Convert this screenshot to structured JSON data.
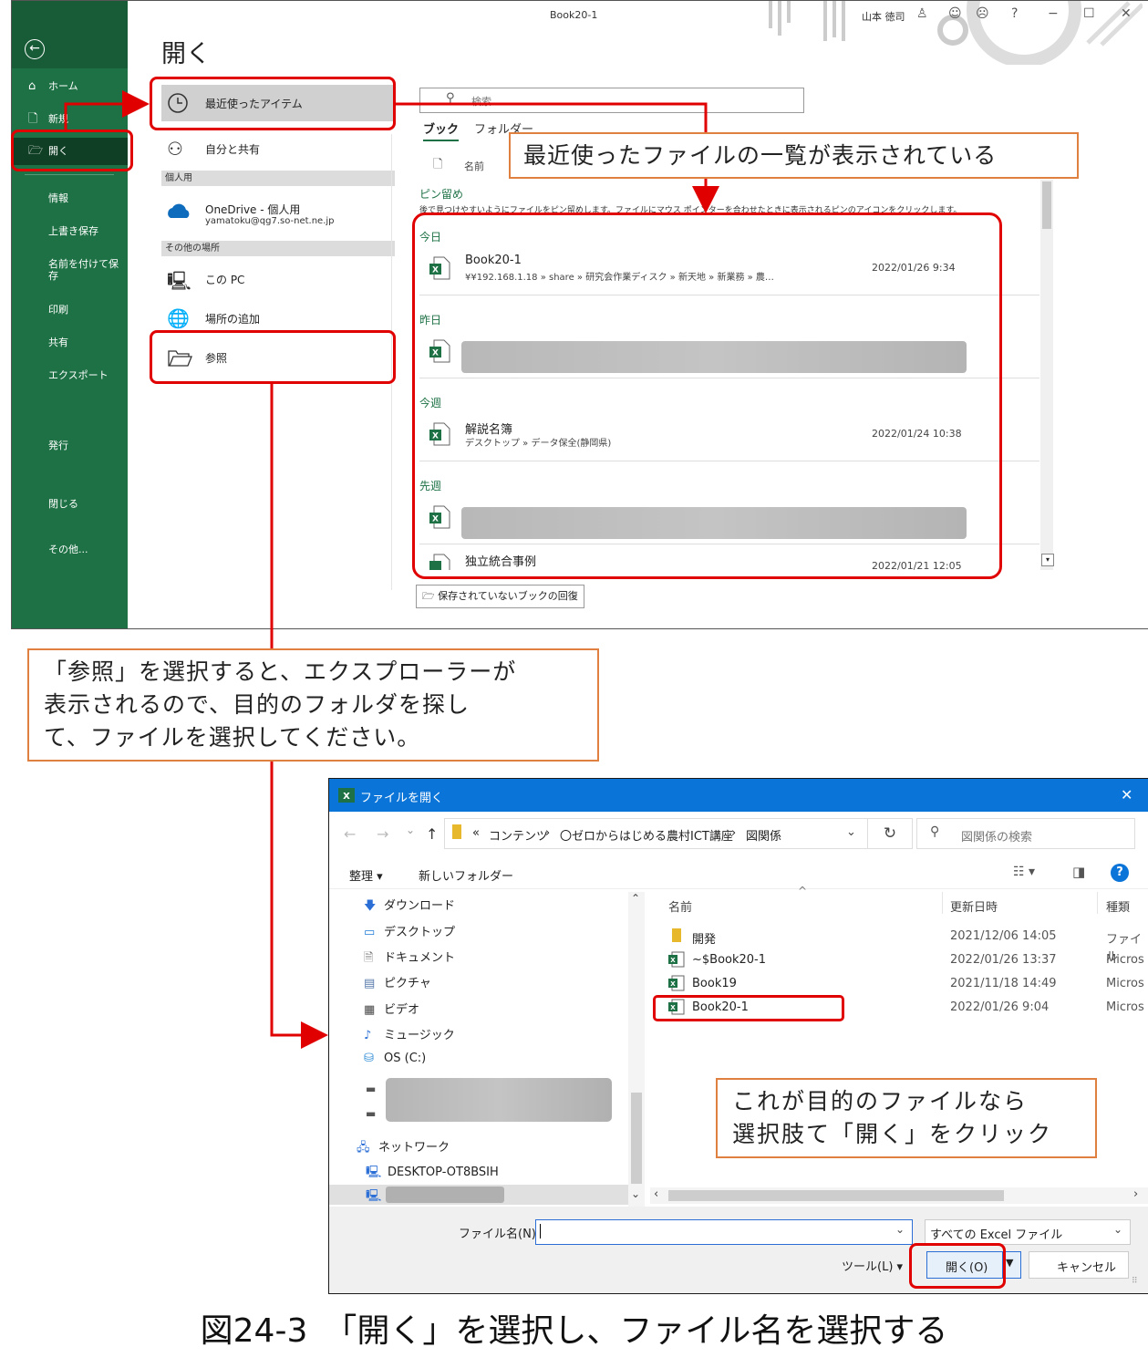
{
  "excel": {
    "window_title": "Book20-1",
    "user_name": "山本 徳司",
    "title_icons": [
      "person-icon",
      "smile-icon",
      "frown-icon",
      "help-icon",
      "minimize-icon",
      "restore-icon",
      "close-icon"
    ],
    "title_glyphs": {
      "help": "?",
      "min": "−",
      "restore": "☐",
      "close": "✕"
    },
    "page_heading": "開く",
    "sidebar": {
      "back": "←",
      "items": [
        {
          "icon": "⌂",
          "label": "ホーム"
        },
        {
          "icon": "🗋",
          "label": "新規"
        },
        {
          "icon": "🗁",
          "label": "開く"
        },
        {
          "label": "情報"
        },
        {
          "label": "上書き保存"
        },
        {
          "label": "名前を付けて保存"
        },
        {
          "label": "印刷"
        },
        {
          "label": "共有"
        },
        {
          "label": "エクスポート"
        },
        {
          "label": "発行"
        },
        {
          "label": "閉じる"
        },
        {
          "label": "その他..."
        }
      ]
    },
    "locations": {
      "recent": "最近使ったアイテム",
      "shared": "自分と共有",
      "personal_header": "個人用",
      "onedrive": "OneDrive - 個人用",
      "onedrive_email": "yamatoku@qg7.so-net.ne.jp",
      "other_header": "その他の場所",
      "this_pc": "この PC",
      "add_place": "場所の追加",
      "browse": "参照"
    },
    "search_placeholder": "検索",
    "tabs": [
      "ブック",
      "フォルダー"
    ],
    "column_name": "名前",
    "pinned_header": "ピン留め",
    "pinned_text": "後で見つけやすいようにファイルをピン留めします。ファイルにマウス ポインターを合わせたときに表示されるピンのアイコンをクリックします。",
    "groups": {
      "today": "今日",
      "yesterday": "昨日",
      "this_week": "今週",
      "last_week": "先週"
    },
    "files": [
      {
        "name": "Book20-1",
        "path": "¥¥192.168.1.18 » share » 研究会作業ディスク » 新天地 » 新業務 » 農…",
        "date": "2022/01/26 9:34"
      },
      {
        "name": "解説名簿",
        "path": "デスクトップ » データ保全(静岡県)",
        "date": "2022/01/24 10:38"
      },
      {
        "name": "独立統合事例",
        "path": "",
        "date": "2022/01/21 12:05"
      }
    ],
    "recover_button": "保存されていないブックの回復"
  },
  "callouts": {
    "recent": "最近使ったファイルの一覧が表示されている",
    "browse": [
      "「参照」を選択すると、エクスプローラーが",
      "表示されるので、目的のフォルダを探し",
      "て、ファイルを選択してください。"
    ],
    "open": [
      "これが目的のファイルなら",
      "選択肢て「開く」をクリック"
    ]
  },
  "dialog": {
    "title": "ファイルを開く",
    "close_glyph": "✕",
    "nav_arrows": [
      "←",
      "→",
      "⌄",
      "↑"
    ],
    "breadcrumb": [
      "«",
      "コンテンツ",
      "›",
      "〇ゼロからはじめる農村ICT講座",
      "›",
      "図関係"
    ],
    "search_placeholder": "図関係の検索",
    "toolbar": {
      "organize": "整理 ▾",
      "new_folder": "新しいフォルダー"
    },
    "tree": [
      {
        "icon": "🡇",
        "label": "ダウンロード"
      },
      {
        "icon": "▭",
        "label": "デスクトップ"
      },
      {
        "icon": "🗎",
        "label": "ドキュメント"
      },
      {
        "icon": "▤",
        "label": "ピクチャ"
      },
      {
        "icon": "▦",
        "label": "ビデオ"
      },
      {
        "icon": "♪",
        "label": "ミュージック"
      },
      {
        "icon": "⛁",
        "label": "OS (C:)"
      }
    ],
    "network": "ネットワーク",
    "desktop_pc": "DESKTOP-OT8BSIH",
    "columns": {
      "name": "名前",
      "date": "更新日時",
      "type": "種類"
    },
    "file_list": [
      {
        "name": "開発",
        "date": "2021/12/06 14:05",
        "type": "ファイル"
      },
      {
        "name": "~$Book20-1",
        "date": "2022/01/26 13:37",
        "type": "Micros"
      },
      {
        "name": "Book19",
        "date": "2021/11/18 14:49",
        "type": "Micros"
      },
      {
        "name": "Book20-1",
        "date": "2022/01/26 9:04",
        "type": "Micros"
      }
    ],
    "filename_label": "ファイル名(N):",
    "filename_value": "",
    "filter": "すべての Excel ファイル",
    "tools": "ツール(L)",
    "open_button": "開く(O)",
    "cancel_button": "キャンセル"
  },
  "caption": "図24-3　「開く」を選択し、ファイル名を選択する",
  "colors": {
    "excel_green": "#1e7145",
    "excel_dark": "#185c37",
    "dialog_blue": "#0a74d8",
    "annotation_red": "#e00000",
    "callout_orange": "#e08040"
  }
}
